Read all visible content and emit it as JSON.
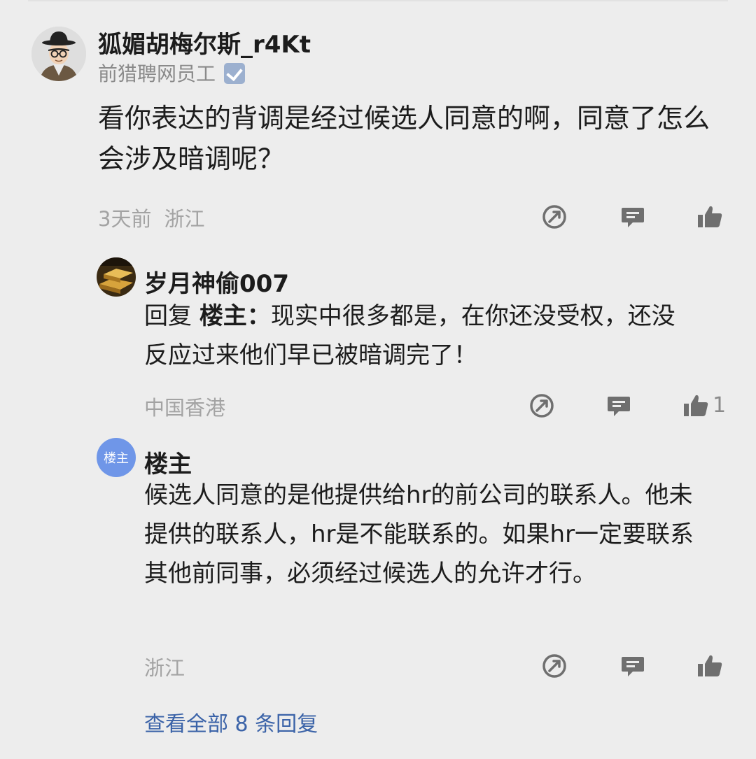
{
  "comment": {
    "author": "狐媚胡梅尔斯_r4Kt",
    "author_title": "前猎聘网员工",
    "text": "看你表达的背调是经过候选人同意的啊，同意了怎么会涉及暗调呢？",
    "time": "3天前",
    "location": "浙江"
  },
  "replies": [
    {
      "author": "岁月神偷007",
      "reply_prefix": "回复",
      "reply_target": "楼主：",
      "text": "现实中很多都是，在你还没受权，还没反应过来他们早已被暗调完了！",
      "location": "中国香港",
      "like_count": "1"
    },
    {
      "author": "楼主",
      "avatar_text": "楼主",
      "text": "候选人同意的是他提供给hr的前公司的联系人。他未提供的联系人，hr是不能联系的。如果hr一定要联系其他前同事，必须经过候选人的允许才行。",
      "location": "浙江"
    }
  ],
  "view_all": "查看全部 8 条回复",
  "icons": [
    "share-icon",
    "comment-icon",
    "thumbs-up-icon"
  ],
  "colors": {
    "background": "#ededed",
    "link": "#3b63a8",
    "meta": "#a3a3a3",
    "icon": "#6f6f6f"
  }
}
